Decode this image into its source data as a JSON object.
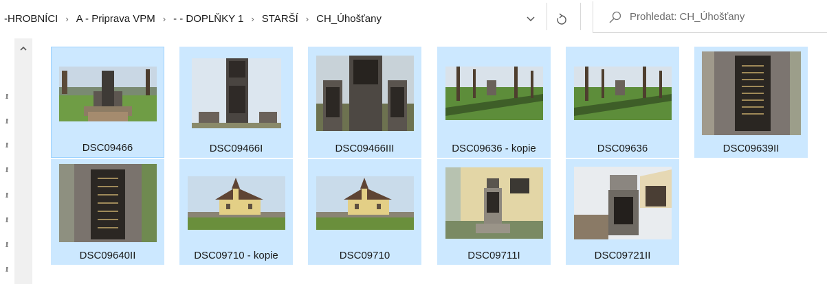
{
  "breadcrumb": {
    "items": [
      "-HROBNÍCI",
      "A - Priprava VPM",
      "- - DOPLŇKY 1",
      "STARŠÍ",
      "CH_Úhošťany"
    ],
    "separator": "›"
  },
  "search": {
    "placeholder": "Prohledat: CH_Úhošťany"
  },
  "icons": {
    "dropdown": "chevron-down-icon",
    "refresh": "refresh-icon",
    "search": "search-icon",
    "scroll_up": "chevron-up-icon"
  },
  "colors": {
    "selection_bg": "#cce8ff",
    "selection_border": "#99d1ff"
  },
  "files": [
    {
      "name": "DSC09466"
    },
    {
      "name": "DSC09466I"
    },
    {
      "name": "DSC09466III"
    },
    {
      "name": "DSC09636 - kopie"
    },
    {
      "name": "DSC09636"
    },
    {
      "name": "DSC09639II"
    },
    {
      "name": "DSC09640II"
    },
    {
      "name": "DSC09710 - kopie"
    },
    {
      "name": "DSC09710"
    },
    {
      "name": "DSC09711I"
    },
    {
      "name": "DSC09721II"
    }
  ]
}
